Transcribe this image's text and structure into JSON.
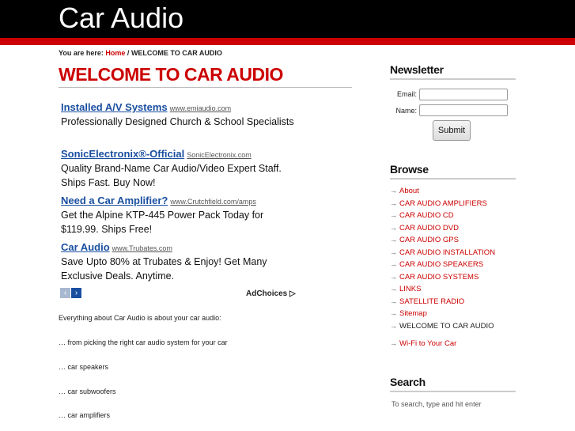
{
  "site_title": "Car Audio",
  "breadcrumb": {
    "prefix": "You are here:",
    "home": "Home",
    "sep": "/",
    "current": "WELCOME TO CAR AUDIO"
  },
  "page_title": "WELCOME TO CAR AUDIO",
  "ads": [
    {
      "title": "Installed A/V Systems",
      "url": "www.emiaudio.com",
      "desc": "Professionally Designed Church & School Specialists"
    },
    {
      "title": "SonicElectronix®-Official",
      "url": "SonicElectronix.com",
      "desc": "Quality Brand-Name Car Audio/Video Expert Staff. Ships Fast. Buy Now!"
    },
    {
      "title": "Need a Car Amplifier?",
      "url": "www.Crutchfield.com/amps",
      "desc": "Get the Alpine KTP-445 Power Pack Today for $119.99. Ships Free!"
    },
    {
      "title": "Car Audio",
      "url": "www.Trubates.com",
      "desc": "Save Upto 80% at Trubates & Enjoy! Get Many Exclusive Deals. Anytime."
    }
  ],
  "ad_nav": {
    "prev": "‹",
    "next": "›"
  },
  "adchoices": "AdChoices ▷",
  "body_lines": [
    "Everything about Car Audio is about your car audio:",
    "… from picking the right car audio system for your car",
    "… car speakers",
    "… car subwoofers",
    "… car amplifiers"
  ],
  "newsletter": {
    "heading": "Newsletter",
    "email_label": "Email:",
    "name_label": "Name:",
    "email_value": "",
    "name_value": "",
    "submit_label": "Submit"
  },
  "browse": {
    "heading": "Browse",
    "arrow": "→",
    "items": [
      {
        "label": "About",
        "link": true
      },
      {
        "label": "CAR AUDIO AMPLIFIERS",
        "link": true
      },
      {
        "label": "CAR AUDIO CD",
        "link": true
      },
      {
        "label": "CAR AUDIO DVD",
        "link": true
      },
      {
        "label": "CAR AUDIO GPS",
        "link": true
      },
      {
        "label": "CAR AUDIO INSTALLATION",
        "link": true
      },
      {
        "label": "CAR AUDIO SPEAKERS",
        "link": true
      },
      {
        "label": "CAR AUDIO SYSTEMS",
        "link": true
      },
      {
        "label": "LINKS",
        "link": true
      },
      {
        "label": "SATELLITE RADIO",
        "link": true
      },
      {
        "label": "Sitemap",
        "link": true
      },
      {
        "label": "WELCOME TO CAR AUDIO",
        "link": false
      }
    ],
    "extra": "Wi-Fi to Your Car"
  },
  "search": {
    "heading": "Search",
    "placeholder": "To search, type and hit enter"
  },
  "colors": {
    "accent": "#cc0000",
    "header_bg": "#000000",
    "ad_link": "#1a4fa0"
  }
}
